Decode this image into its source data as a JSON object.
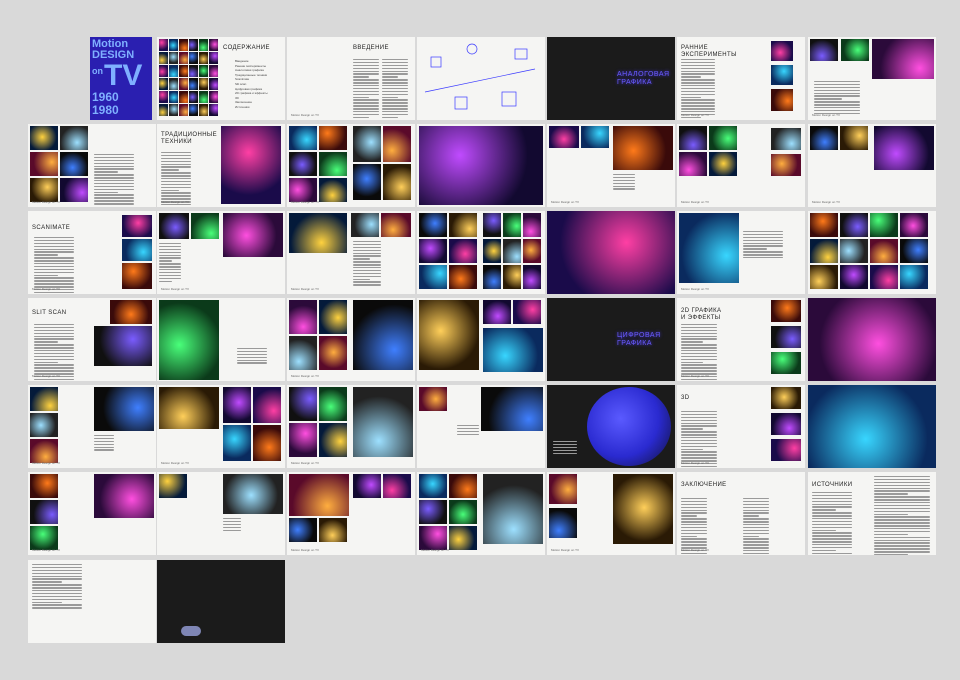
{
  "book": {
    "cover": {
      "line1": "Motion",
      "line2": "DESIGN",
      "line3": "on",
      "line4": "TV",
      "line5": "1960",
      "line6": "1980"
    },
    "footer_label": "Motion Design on TV",
    "toc": {
      "title": "СОДЕРЖАНИЕ",
      "items": [
        "Введение",
        "Ранние эксперименты",
        "Аналоговая графика",
        "Традиционные техники",
        "Scanimate",
        "Slit scan",
        "Цифровая графика",
        "2D графика и эффекты",
        "3D",
        "Заключение",
        "Источники"
      ]
    },
    "chapters": {
      "intro": "ВВЕДЕНИЕ",
      "early": "РАННИЕ\nЭКСПЕРИМЕНТЫ",
      "analog": "АНАЛОГОВАЯ\nГРАФИКА",
      "traditional": "ТРАДИЦИОННЫЕ\nТЕХНИКИ",
      "scanimate": "SCANIMATE",
      "slitscan": "SLIT SCAN",
      "digital": "ЦИФРОВАЯ\nГРАФИКА",
      "twod": "2D ГРАФИКА\nИ ЭФФЕКТЫ",
      "threed": "3D",
      "conclusion": "ЗАКЛЮЧЕНИЕ",
      "sources": "ИСТОЧНИКИ"
    },
    "colors": {
      "background": "#d9d9d9",
      "page": "#f5f5f3",
      "dark_page": "#1b1b1b",
      "neon": "#6a5bff",
      "cover_blue": "#2a1fb0"
    },
    "logo_icon": "tv-logo-icon"
  }
}
